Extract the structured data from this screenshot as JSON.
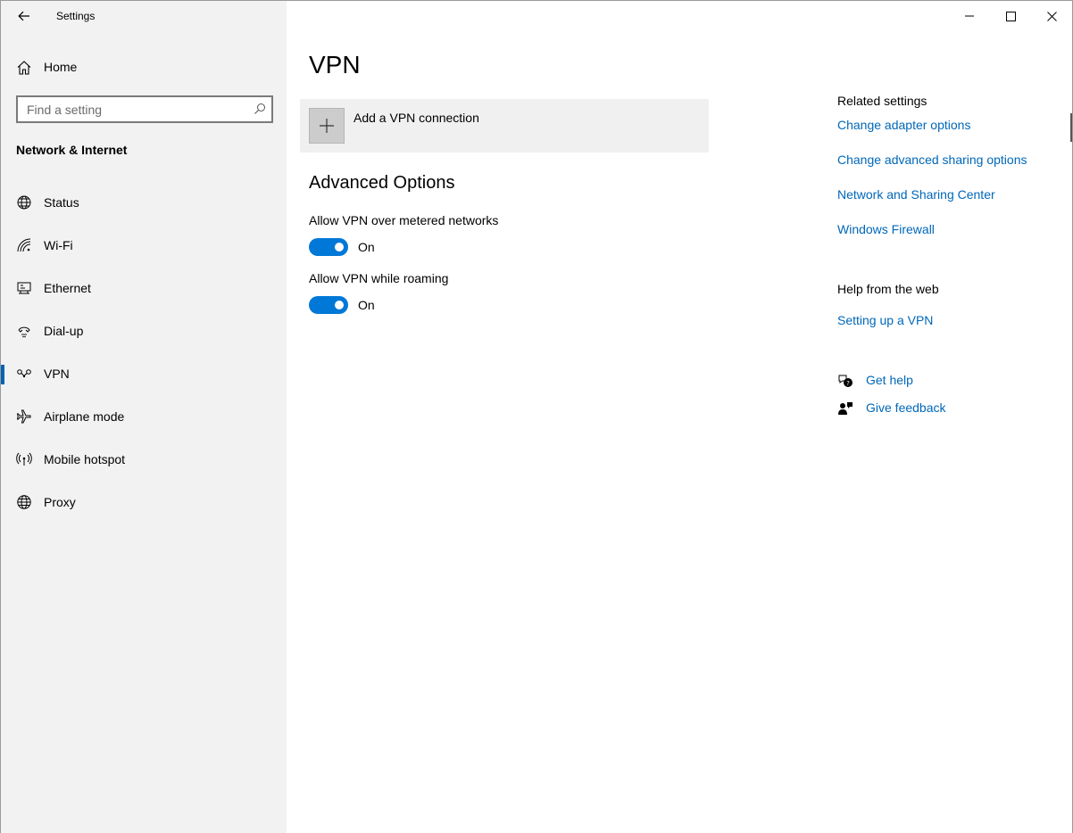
{
  "app": {
    "title": "Settings"
  },
  "sidebar": {
    "home_label": "Home",
    "search_placeholder": "Find a setting",
    "section_heading": "Network & Internet",
    "items": [
      {
        "label": "Status",
        "icon": "globe-status-icon"
      },
      {
        "label": "Wi-Fi",
        "icon": "wifi-icon"
      },
      {
        "label": "Ethernet",
        "icon": "ethernet-icon"
      },
      {
        "label": "Dial-up",
        "icon": "dialup-icon"
      },
      {
        "label": "VPN",
        "icon": "vpn-icon",
        "active": true
      },
      {
        "label": "Airplane mode",
        "icon": "airplane-icon"
      },
      {
        "label": "Mobile hotspot",
        "icon": "hotspot-icon"
      },
      {
        "label": "Proxy",
        "icon": "globe-icon"
      }
    ]
  },
  "main": {
    "title": "VPN",
    "add_vpn_label": "Add a VPN connection",
    "advanced_title": "Advanced Options",
    "toggles": [
      {
        "label": "Allow VPN over metered networks",
        "state": "On",
        "on": true
      },
      {
        "label": "Allow VPN while roaming",
        "state": "On",
        "on": true
      }
    ]
  },
  "related": {
    "heading": "Related settings",
    "links": [
      "Change adapter options",
      "Change advanced sharing options",
      "Network and Sharing Center",
      "Windows Firewall"
    ],
    "help_heading": "Help from the web",
    "help_links": [
      "Setting up a VPN"
    ],
    "get_help": "Get help",
    "give_feedback": "Give feedback"
  },
  "colors": {
    "accent": "#0078d7",
    "link": "#0067b8",
    "sidebar_bg": "#f2f2f2"
  }
}
